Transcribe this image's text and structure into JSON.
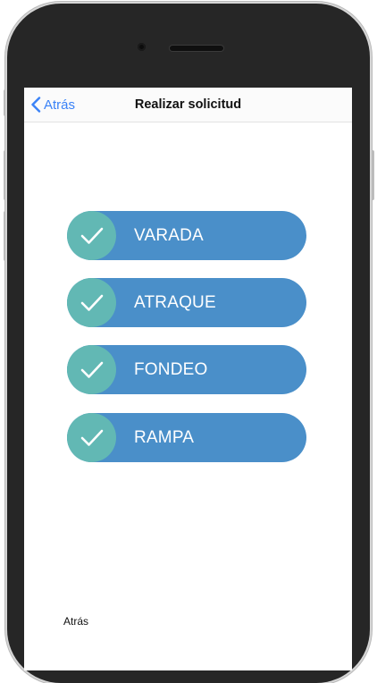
{
  "navbar": {
    "back_label": "Atrás",
    "title": "Realizar solicitud"
  },
  "options": [
    {
      "label": "VARADA",
      "checked": true
    },
    {
      "label": "ATRAQUE",
      "checked": true
    },
    {
      "label": "FONDEO",
      "checked": true
    },
    {
      "label": "RAMPA",
      "checked": true
    }
  ],
  "footer": {
    "back_label": "Atrás"
  },
  "colors": {
    "accent_blue": "#3a82f7",
    "option_bg": "#4a8fc9",
    "check_circle": "#62b8b4",
    "phone_body": "#262626"
  },
  "icons": {
    "back": "chevron-left-icon",
    "check": "checkmark-icon"
  }
}
